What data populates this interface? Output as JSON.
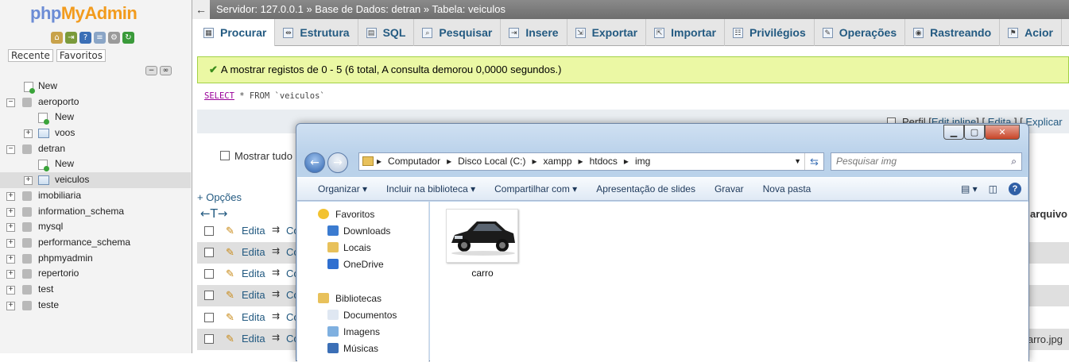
{
  "logo": {
    "part1": "php",
    "part2": "MyAdmin"
  },
  "left_tabs": [
    "Recente",
    "Favoritos"
  ],
  "tree": [
    {
      "label": "New",
      "level": 1,
      "kind": "new"
    },
    {
      "label": "aeroporto",
      "level": 0,
      "kind": "db",
      "expand": "−"
    },
    {
      "label": "New",
      "level": 2,
      "kind": "new"
    },
    {
      "label": "voos",
      "level": 2,
      "kind": "table",
      "expand": "+"
    },
    {
      "label": "detran",
      "level": 0,
      "kind": "db",
      "expand": "−"
    },
    {
      "label": "New",
      "level": 2,
      "kind": "new"
    },
    {
      "label": "veiculos",
      "level": 2,
      "kind": "table",
      "expand": "+",
      "selected": true
    },
    {
      "label": "imobiliaria",
      "level": 0,
      "kind": "db",
      "expand": "+"
    },
    {
      "label": "information_schema",
      "level": 0,
      "kind": "db",
      "expand": "+"
    },
    {
      "label": "mysql",
      "level": 0,
      "kind": "db",
      "expand": "+"
    },
    {
      "label": "performance_schema",
      "level": 0,
      "kind": "db",
      "expand": "+"
    },
    {
      "label": "phpmyadmin",
      "level": 0,
      "kind": "db",
      "expand": "+"
    },
    {
      "label": "repertorio",
      "level": 0,
      "kind": "db",
      "expand": "+"
    },
    {
      "label": "test",
      "level": 0,
      "kind": "db",
      "expand": "+"
    },
    {
      "label": "teste",
      "level": 0,
      "kind": "db",
      "expand": "+"
    }
  ],
  "breadcrumb": "Servidor: 127.0.0.1 » Base de Dados: detran » Tabela: veiculos",
  "tabs": [
    {
      "label": "Procurar",
      "icon": "browse-icon",
      "active": true
    },
    {
      "label": "Estrutura",
      "icon": "structure-icon"
    },
    {
      "label": "SQL",
      "icon": "sql-icon"
    },
    {
      "label": "Pesquisar",
      "icon": "search-icon"
    },
    {
      "label": "Insere",
      "icon": "insert-icon"
    },
    {
      "label": "Exportar",
      "icon": "export-icon"
    },
    {
      "label": "Importar",
      "icon": "import-icon"
    },
    {
      "label": "Privilégios",
      "icon": "privileges-icon"
    },
    {
      "label": "Operações",
      "icon": "operations-icon"
    },
    {
      "label": "Rastreando",
      "icon": "tracking-icon"
    },
    {
      "label": "Acior",
      "icon": "triggers-icon"
    }
  ],
  "success_message": "A mostrar registos de 0 - 5 (6 total, A consulta demorou 0,0000 segundos.)",
  "sql": {
    "select": "SELECT",
    "rest": " * FROM `veiculos`"
  },
  "perfil": {
    "label": "Perfil",
    "edit_inline": "Edit inline",
    "edita": "Edita",
    "explicar": "Explicar"
  },
  "mostrar_tudo": "Mostrar tudo",
  "opcoes": "+ Opções",
  "column_header": "arquivo",
  "rows": [
    {
      "edit": "Edita",
      "copy": "Co",
      "file": ""
    },
    {
      "edit": "Edita",
      "copy": "Co",
      "file": ""
    },
    {
      "edit": "Edita",
      "copy": "Co",
      "file": ""
    },
    {
      "edit": "Edita",
      "copy": "Co",
      "file": ""
    },
    {
      "edit": "Edita",
      "copy": "Co",
      "file": ""
    },
    {
      "edit": "Edita",
      "copy": "Co",
      "file": "arro.jpg"
    }
  ],
  "explorer": {
    "address": [
      "Computador",
      "Disco Local (C:)",
      "xampp",
      "htdocs",
      "img"
    ],
    "search_placeholder": "Pesquisar img",
    "toolbar": [
      "Organizar ▾",
      "Incluir na biblioteca ▾",
      "Compartilhar com ▾",
      "Apresentação de slides",
      "Gravar",
      "Nova pasta"
    ],
    "nav": [
      {
        "label": "Favoritos",
        "indent": 0,
        "icon": "star-icon"
      },
      {
        "label": "Downloads",
        "indent": 1,
        "icon": "downloads-icon"
      },
      {
        "label": "Locais",
        "indent": 1,
        "icon": "places-icon"
      },
      {
        "label": "OneDrive",
        "indent": 1,
        "icon": "onedrive-icon"
      },
      {
        "label": "Bibliotecas",
        "indent": 0,
        "icon": "libraries-icon",
        "gap": true
      },
      {
        "label": "Documentos",
        "indent": 1,
        "icon": "documents-icon"
      },
      {
        "label": "Imagens",
        "indent": 1,
        "icon": "images-icon"
      },
      {
        "label": "Músicas",
        "indent": 1,
        "icon": "music-icon"
      }
    ],
    "file": {
      "name": "carro"
    }
  }
}
